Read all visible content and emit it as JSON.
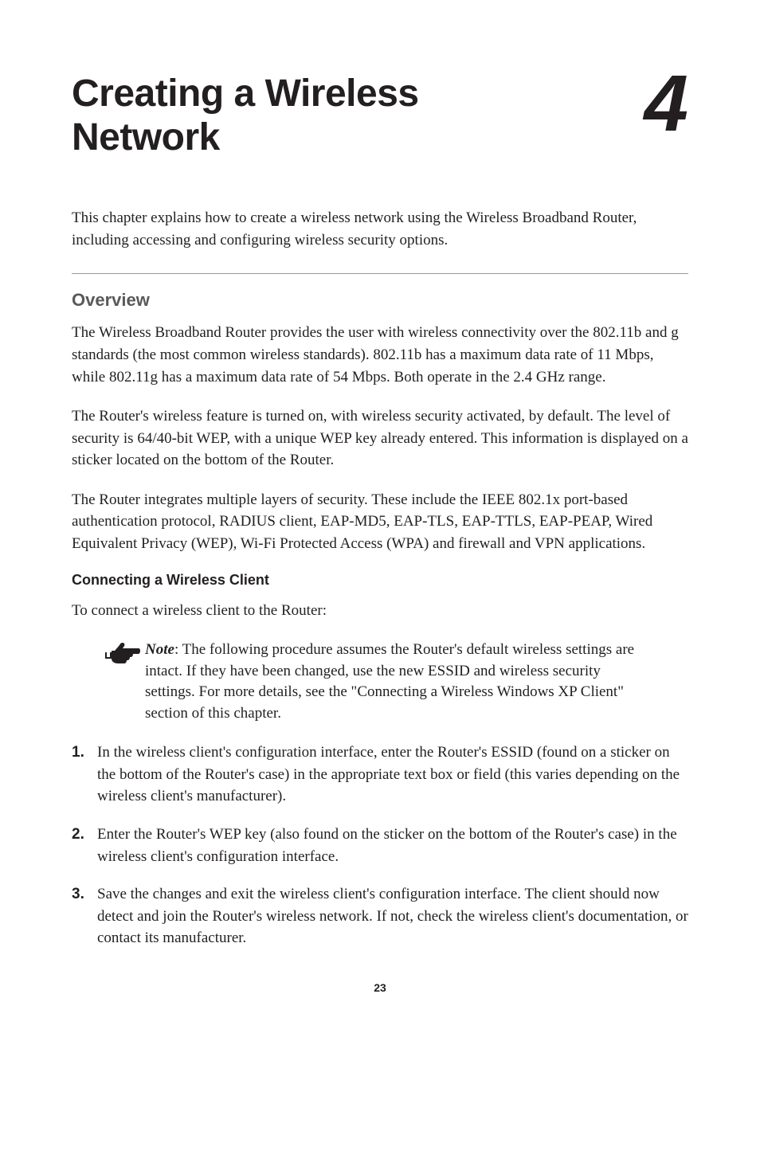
{
  "chapter": {
    "title_line1": "Creating a Wireless",
    "title_line2": "Network",
    "number": "4"
  },
  "intro": "This chapter explains how to create a wireless network using the Wireless Broadband Router, including accessing and configuring wireless security options.",
  "section": {
    "heading": "Overview",
    "para1": "The Wireless Broadband Router provides the user with wireless connectivity over the 802.11b and g standards (the most common wireless standards). 802.11b has a maximum data rate of 11 Mbps, while 802.11g has a maximum data rate of 54 Mbps. Both operate in the 2.4 GHz range.",
    "para2": "The Router's wireless feature is turned on, with wireless security activated, by default. The level of security is  64/40-bit WEP, with a unique WEP key already entered.  This information is displayed on a sticker located on the bottom of the Router.",
    "para3": "The Router integrates multiple layers of security. These include the IEEE 802.1x port-based authentication protocol, RADIUS client, EAP-MD5, EAP-TLS, EAP-TTLS, EAP-PEAP, Wired Equivalent Privacy (WEP), Wi-Fi Protected Access (WPA) and firewall and VPN applications."
  },
  "subsection": {
    "heading": "Connecting a Wireless Client",
    "intro": "To connect a wireless client to the Router:",
    "note_label": "Note",
    "note_text": ": The following procedure assumes the Router's default wireless settings are intact. If they have been changed, use the new ESSID and wireless security settings. For more details, see the \"Connecting a Wireless Windows XP Client\" section of this chapter.",
    "steps": [
      {
        "num": "1.",
        "text": "In the wireless client's configuration interface, enter the Router's ESSID (found on a sticker on the bottom of the Router's case) in the appropriate text box or field (this varies depending on the wireless client's manufacturer)."
      },
      {
        "num": "2.",
        "text": "Enter the Router's WEP key (also found on the sticker on the bottom of the Router's case) in the wireless client's configuration interface."
      },
      {
        "num": "3.",
        "text": "Save the changes and exit the wireless client's configuration interface. The client should now detect and join the Router's wireless network. If not, check the wireless client's documentation, or contact its manufacturer."
      }
    ]
  },
  "page_number": "23"
}
